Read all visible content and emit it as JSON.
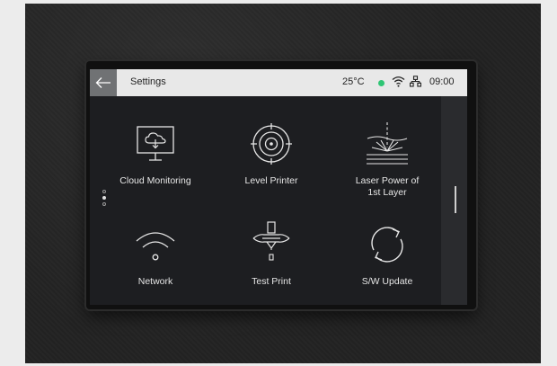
{
  "header": {
    "back_icon": "arrow-left-icon",
    "title": "Settings",
    "temperature": "25°C",
    "status_dot_color": "#2fc574",
    "wifi_icon": "wifi-icon",
    "lan_icon": "network-lan-icon",
    "time": "09:00"
  },
  "pager": {
    "pages": 3,
    "active": 1
  },
  "scroll_position": 0.45,
  "tiles": [
    {
      "label": "Cloud Monitoring",
      "icon": "cloud-monitor-icon"
    },
    {
      "label": "Level Printer",
      "icon": "target-icon"
    },
    {
      "label": "Laser Power of\n1st Layer",
      "icon": "laser-icon"
    },
    {
      "label": "Network",
      "icon": "wifi-icon"
    },
    {
      "label": "Test Print",
      "icon": "nozzle-icon"
    },
    {
      "label": "S/W Update",
      "icon": "refresh-icon"
    }
  ]
}
